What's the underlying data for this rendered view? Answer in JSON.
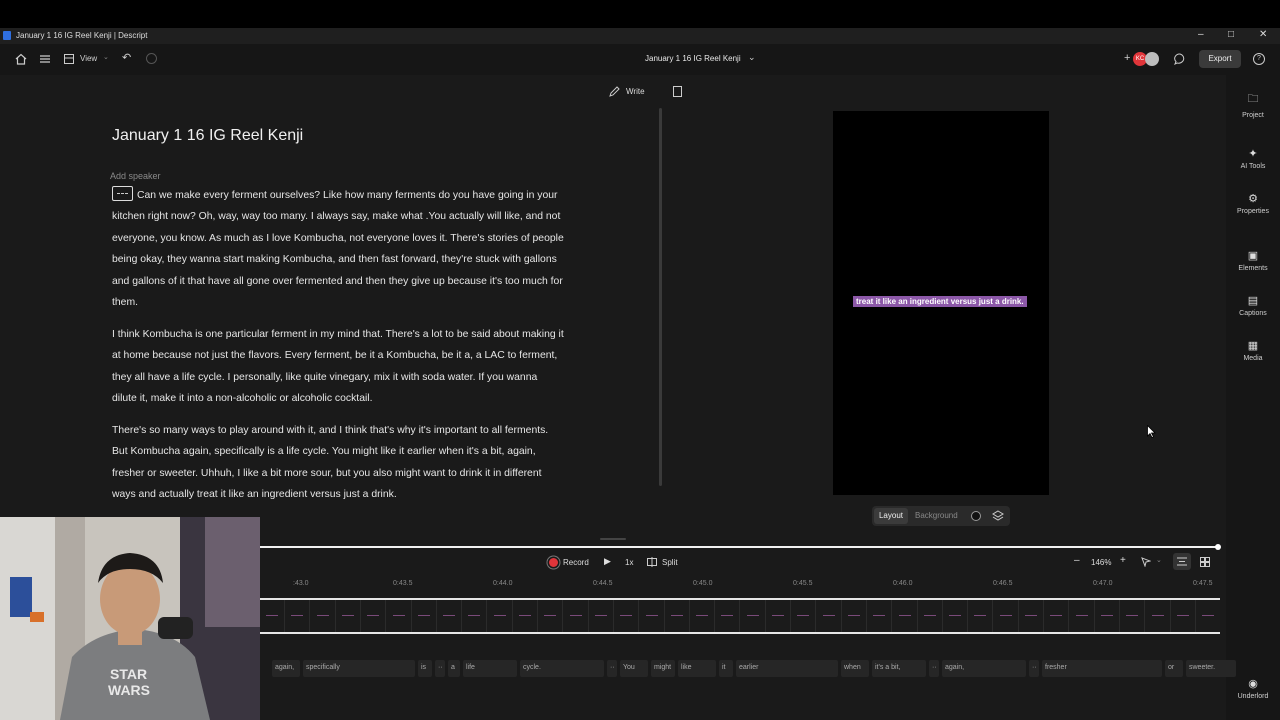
{
  "window": {
    "title": "January 1 16 IG Reel Kenji | Descript"
  },
  "toolbar": {
    "view_label": "View",
    "project_title": "January 1 16 IG Reel Kenji",
    "export_label": "Export",
    "avatar_initials": "KC"
  },
  "doc_header": {
    "write_label": "Write"
  },
  "document": {
    "title": "January 1 16 IG Reel Kenji",
    "add_speaker": "Add speaker",
    "paragraphs": [
      "Can we make every ferment ourselves? Like how many ferments do you have going in your kitchen right now? Oh, way, way too many. I always say, make what .You actually will like, and not everyone, you know. As much as I love Kombucha, not everyone loves it. There's stories of people being okay, they wanna start making Kombucha, and then fast forward, they're stuck with gallons and gallons of it that have all gone over fermented and then they give up because it's too much for them.",
      "I think Kombucha is one particular ferment in my mind that. There's a lot to be said about making it at home because not just the flavors. Every ferment, be it a Kombucha, be it a, a LAC to ferment, they all have a life cycle. I personally, like quite vinegary, mix it with soda water. If you wanna dilute it, make it into a non-alcoholic or alcoholic cocktail.",
      "There's so many ways to play around with it, and I think that's why it's important to all ferments. But Kombucha again, specifically is a life cycle. You might like it earlier when it's a bit, again, fresher or sweeter. Uhhuh, I like a bit more sour, but you also might want to drink it in different ways and actually treat it like an ingredient versus just a drink."
    ]
  },
  "preview": {
    "caption": "treat it like an ingredient versus just a drink.",
    "layout_label": "Layout",
    "background_label": "Background"
  },
  "right_panel": [
    {
      "label": "Project",
      "icon": "folder-icon"
    },
    {
      "label": "AI Tools",
      "icon": "sparkle-icon"
    },
    {
      "label": "Properties",
      "icon": "sliders-icon"
    },
    {
      "label": "Elements",
      "icon": "shapes-icon"
    },
    {
      "label": "Captions",
      "icon": "captions-icon"
    },
    {
      "label": "Media",
      "icon": "media-icon"
    },
    {
      "label": "Underlord",
      "icon": "robot-icon"
    }
  ],
  "timeline": {
    "record_label": "Record",
    "speed_label": "1x",
    "split_label": "Split",
    "zoom_label": "146%",
    "ruler_ticks": [
      ":43.0",
      "0:43.5",
      "0:44.0",
      "0:44.5",
      "0:45.0",
      "0:45.5",
      "0:46.0",
      "0:46.5",
      "0:47.0",
      "0:47.5"
    ],
    "words": [
      "again,",
      "specifically",
      "is",
      "··",
      "a",
      "life",
      "cycle.",
      "··",
      "You",
      "might",
      "like",
      "it",
      "earlier",
      "when",
      "it's a bit,",
      "··",
      "again,",
      "··",
      "fresher",
      "or",
      "sweeter."
    ]
  },
  "colors": {
    "accent_purple": "#8c58a8",
    "record_red": "#e0353a",
    "brand_blue": "#2f6fe0"
  }
}
